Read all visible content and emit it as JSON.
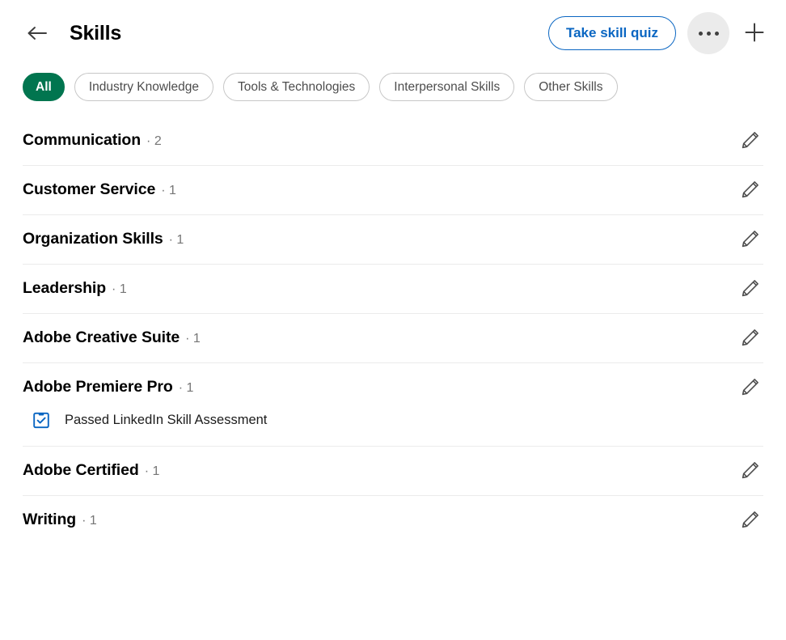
{
  "header": {
    "back_icon": "arrow-left-icon",
    "title": "Skills",
    "quiz_button_label": "Take skill quiz",
    "more_icon": "ellipsis-icon",
    "add_icon": "plus-icon"
  },
  "filters": [
    {
      "label": "All",
      "active": true
    },
    {
      "label": "Industry Knowledge",
      "active": false
    },
    {
      "label": "Tools & Technologies",
      "active": false
    },
    {
      "label": "Interpersonal Skills",
      "active": false
    },
    {
      "label": "Other Skills",
      "active": false
    }
  ],
  "skills": [
    {
      "name": "Communication",
      "count": "· 2",
      "edit_icon": "pencil-icon"
    },
    {
      "name": "Customer Service",
      "count": "· 1",
      "edit_icon": "pencil-icon"
    },
    {
      "name": "Organization Skills",
      "count": "· 1",
      "edit_icon": "pencil-icon"
    },
    {
      "name": "Leadership",
      "count": "· 1",
      "edit_icon": "pencil-icon"
    },
    {
      "name": "Adobe Creative Suite",
      "count": "· 1",
      "edit_icon": "pencil-icon"
    },
    {
      "name": "Adobe Premiere Pro",
      "count": "· 1",
      "edit_icon": "pencil-icon",
      "assessment": {
        "icon": "clipboard-check-icon",
        "label": "Passed LinkedIn Skill Assessment"
      }
    },
    {
      "name": "Adobe Certified",
      "count": "· 1",
      "edit_icon": "pencil-icon"
    },
    {
      "name": "Writing",
      "count": "· 1",
      "edit_icon": "pencil-icon"
    }
  ],
  "colors": {
    "accent_green": "#01754F",
    "accent_blue": "#0A66C2",
    "text_primary": "#000000",
    "text_secondary": "#767676",
    "divider": "#EBEBEB",
    "more_button_bg": "#EBEBEB"
  }
}
